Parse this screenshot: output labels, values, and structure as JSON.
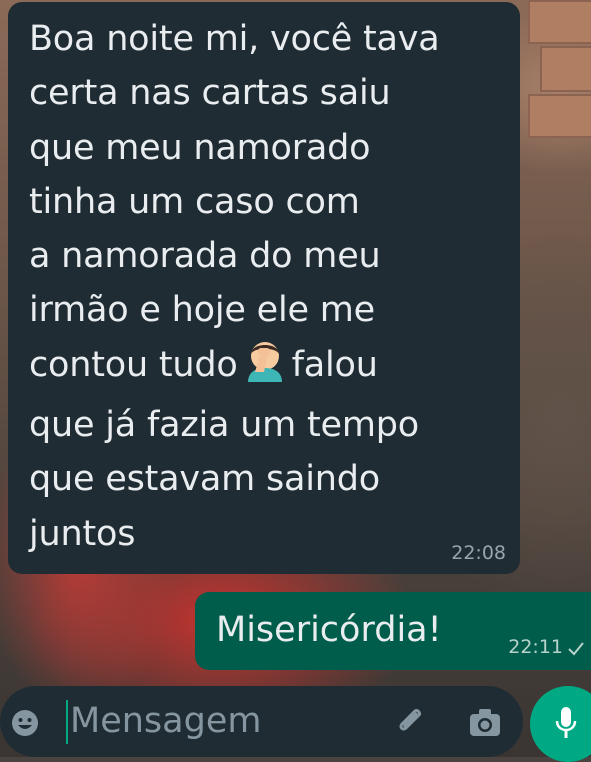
{
  "chat": {
    "incoming": {
      "text": "Boa noite mi, você tava\ncerta nas cartas saiu\nque meu namorado\ntinha um caso com\na namorada do meu\nirmão e hoje ele me\ncontou tudo",
      "text_after_emoji": "falou\nque já fazia um tempo\nque estavam saindo\njuntos",
      "emoji": "face-palm-emoji",
      "time": "22:08"
    },
    "outgoing": {
      "text": "Misericórdia!",
      "time": "22:11",
      "status_icon": "check-icon"
    }
  },
  "composer": {
    "placeholder": "Mensagem",
    "emoji_icon": "emoji-icon",
    "attach_icon": "paperclip-icon",
    "camera_icon": "camera-icon",
    "mic_icon": "microphone-icon"
  },
  "colors": {
    "incoming_bubble": "#1f2c33",
    "outgoing_bubble": "#005c4b",
    "accent": "#00a884"
  }
}
